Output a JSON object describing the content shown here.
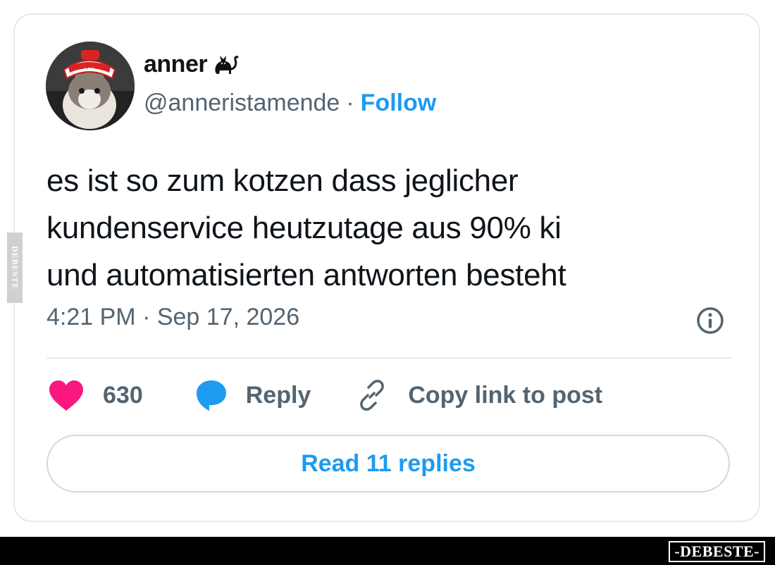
{
  "tweet": {
    "display_name": "anner",
    "handle": "@anneristamende",
    "separator": "·",
    "follow_label": "Follow",
    "text": "es ist so zum kotzen dass jeglicher\nkundenservice heutzutage aus 90% ki\nund automatisierten antworten besteht",
    "timestamp": "4:21 PM · Sep 17, 2026"
  },
  "actions": {
    "like_count": "630",
    "reply_label": "Reply",
    "copy_link_label": "Copy link to post",
    "read_replies_label": "Read 11 replies"
  },
  "icons": {
    "avatar": "avatar-cat-photo",
    "name_badge": "black-cat-icon",
    "info": "info-icon",
    "like": "heart-icon",
    "reply": "speech-bubble-icon",
    "copy": "link-icon"
  },
  "colors": {
    "accent": "#1d9bf0",
    "heart": "#f91880",
    "text_primary": "#0f1419",
    "text_secondary": "#536471",
    "border": "#e6e9ec"
  },
  "watermark": {
    "side_text": "DEBESTE",
    "footer_text": "-DEBESTE-"
  }
}
